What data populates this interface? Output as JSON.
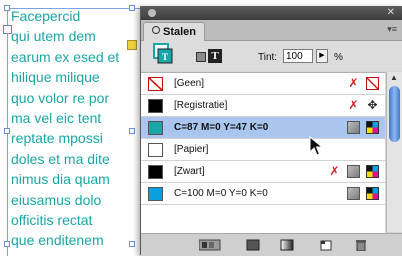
{
  "text_frame": {
    "lines": [
      "Facepercid",
      "qui utem dem",
      "earum ex esed et",
      "hilique milique",
      "quo volor re por",
      "ma vel eic tent",
      "reptate mpossi",
      "doles et ma dite",
      "nimus dia quam",
      "eiusamus dolo",
      "officitis rectat",
      "que enditenem"
    ],
    "text_color": "#1aa6a6"
  },
  "panel": {
    "close_glyph": "✕",
    "tab_label": "Stalen",
    "menu_glyph": "▾≡",
    "tint_label": "Tint:",
    "tint_value": "100",
    "tint_arrow": "▶",
    "tint_unit": "%",
    "swatches": [
      {
        "name": "[Geen]",
        "color": "none",
        "icon_a": "no-edit",
        "icon_b": "none-swatch",
        "selected": false
      },
      {
        "name": "[Registratie]",
        "color": "#000000",
        "icon_a": "no-edit",
        "icon_b": "registration-target",
        "selected": false
      },
      {
        "name": "C=87 M=0 Y=47 K=0",
        "color": "#1aa6a6",
        "icon_a": "process-color",
        "icon_b": "cmyk",
        "selected": true
      },
      {
        "name": "[Papier]",
        "color": "#ffffff",
        "icon_a": "",
        "icon_b": "",
        "selected": false
      },
      {
        "name": "[Zwart]",
        "color": "#000000",
        "icon_a": "no-edit",
        "icon_b": "process-color",
        "icon_c": "cmyk",
        "selected": false
      },
      {
        "name": "C=100 M=0 Y=0 K=0",
        "color": "#0a9fe0",
        "icon_a": "process-color",
        "icon_b": "cmyk",
        "selected": false
      }
    ],
    "footer_buttons": [
      "show-all-swatches",
      "show-color-swatches",
      "show-gradient-swatches",
      "new-swatch",
      "delete-swatch"
    ]
  },
  "colors": {
    "selection": "#a9c7ee",
    "scroll_thumb": "#3f78c8",
    "port_out": "#f0d23a"
  }
}
